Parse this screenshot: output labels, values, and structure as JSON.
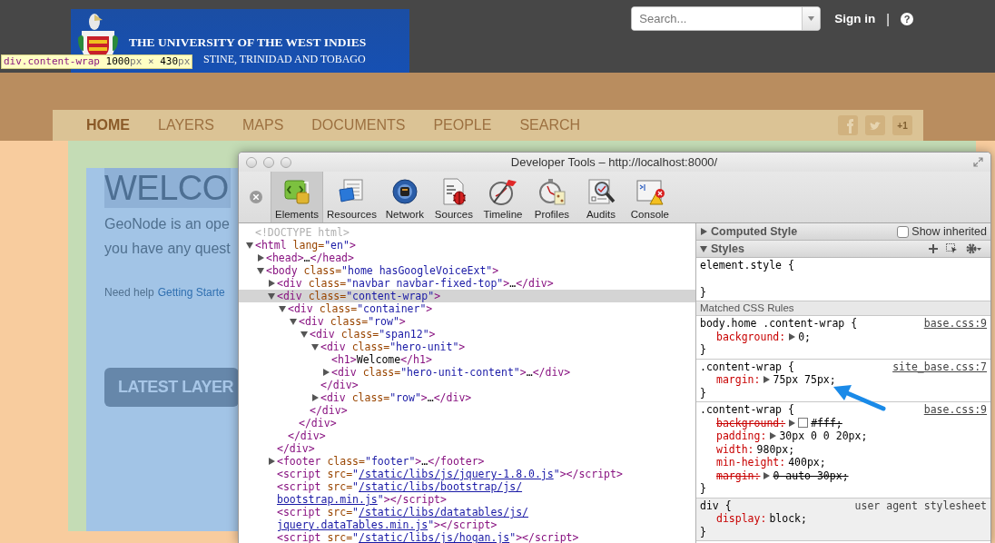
{
  "page": {
    "logo": {
      "title": "THE UNIVERSITY OF THE WEST INDIES",
      "subtitle": "STINE, TRINIDAD AND TOBAGO"
    },
    "search": {
      "placeholder": "Search..."
    },
    "sign_in": "Sign in",
    "divider": "|",
    "help": "?",
    "nav": [
      {
        "label": "HOME",
        "selected": true
      },
      {
        "label": "LAYERS",
        "selected": false
      },
      {
        "label": "MAPS",
        "selected": false
      },
      {
        "label": "DOCUMENTS",
        "selected": false
      },
      {
        "label": "PEOPLE",
        "selected": false
      },
      {
        "label": "SEARCH",
        "selected": false
      }
    ],
    "social": [
      {
        "kind": "facebook"
      },
      {
        "kind": "twitter"
      },
      {
        "kind": "plusone",
        "label": "+1"
      }
    ],
    "hero": {
      "heading": "WELCO",
      "lines": [
        "GeoNode is an ope",
        "you have any quest"
      ],
      "help_text": "Need help",
      "help_link": "Getting Starte",
      "button": "LATEST LAYER"
    }
  },
  "tooltip": {
    "parts": [
      {
        "text": "div.content-wrap ",
        "kind": "selector"
      },
      {
        "text": "1000",
        "kind": "number"
      },
      {
        "text": "px × ",
        "kind": "unit"
      },
      {
        "text": "430",
        "kind": "number"
      },
      {
        "text": "px",
        "kind": "unit"
      }
    ]
  },
  "devtools": {
    "title": "Developer Tools – http://localhost:8000/",
    "tabs": [
      {
        "label": "Elements",
        "selected": true
      },
      {
        "label": "Resources",
        "selected": false
      },
      {
        "label": "Network",
        "selected": false
      },
      {
        "label": "Sources",
        "selected": false
      },
      {
        "label": "Timeline",
        "selected": false
      },
      {
        "label": "Profiles",
        "selected": false
      },
      {
        "label": "Audits",
        "selected": false
      },
      {
        "label": "Console",
        "selected": false
      }
    ]
  },
  "elements": {
    "nodes": [
      {
        "kind": "doctype",
        "text": "<!DOCTYPE html>",
        "selected": false
      },
      {
        "kind": "element",
        "text": "<html lang=\"en\">",
        "selected": false,
        "expanded": true,
        "children": [
          {
            "kind": "element",
            "text": "<head>…</head>",
            "selected": false,
            "expanded": false
          },
          {
            "kind": "element",
            "text": "<body class=\"home hasGoogleVoiceExt\">",
            "selected": false,
            "expanded": true,
            "children": [
              {
                "kind": "element",
                "text": "<div class=\"navbar navbar-fixed-top\">…</div>",
                "selected": false,
                "expanded": false
              },
              {
                "kind": "element",
                "text": "<div class=\"content-wrap\">",
                "selected": true,
                "expanded": true,
                "close": "</div>",
                "children": [
                  {
                    "kind": "element",
                    "text": "<div class=\"container\">",
                    "selected": false,
                    "expanded": true,
                    "close": "</div>",
                    "children": [
                      {
                        "kind": "element",
                        "text": "<div class=\"row\">",
                        "selected": false,
                        "expanded": true,
                        "close": "</div>",
                        "children": [
                          {
                            "kind": "element",
                            "text": "<div class=\"span12\">",
                            "selected": false,
                            "expanded": true,
                            "close": "</div>",
                            "children": [
                              {
                                "kind": "element",
                                "text": "<div class=\"hero-unit\">",
                                "selected": false,
                                "expanded": true,
                                "close": "</div>",
                                "children": [
                                  {
                                    "kind": "element",
                                    "text": "<h1>Welcome</h1>",
                                    "selected": false
                                  },
                                  {
                                    "kind": "element",
                                    "text": "<div class=\"hero-unit-content\">…</div>",
                                    "selected": false,
                                    "expanded": false
                                  }
                                ]
                              },
                              {
                                "kind": "element",
                                "text": "<div class=\"row\">…</div>",
                                "selected": false,
                                "expanded": false
                              }
                            ]
                          }
                        ]
                      }
                    ]
                  }
                ]
              },
              {
                "kind": "element",
                "text": "<footer class=\"footer\">…</footer>",
                "selected": false,
                "expanded": false
              },
              {
                "kind": "element",
                "text": "<script src=\"/static/libs/js/jquery-1.8.0.js\"></script>",
                "selected": false,
                "links": true
              },
              {
                "kind": "element",
                "text": "<script src=\"/static/libs/bootstrap/js/\nbootstrap.min.js\"></script>",
                "selected": false,
                "links": true
              },
              {
                "kind": "element",
                "text": "<script src=\"/static/libs/datatables/js/\njquery.dataTables.min.js\"></script>",
                "selected": false,
                "links": true
              },
              {
                "kind": "element",
                "text": "<script src=\"/static/libs/js/hogan.js\"></script>",
                "selected": false,
                "links": true
              }
            ]
          }
        ]
      }
    ]
  },
  "styles": {
    "computed": {
      "title": "Computed Style",
      "expanded": false,
      "show_inherited": {
        "label": "Show inherited",
        "checked": false
      }
    },
    "styles_header": {
      "title": "Styles",
      "expanded": true
    },
    "matched_label": "Matched CSS Rules",
    "rules": [
      {
        "kind": "inline",
        "selector": "element.style {",
        "close": "}"
      },
      {
        "kind": "author",
        "selector": "body.home .content-wrap {",
        "source": "base.css:9",
        "properties": [
          {
            "name": "background:",
            "value": "0;",
            "expandable": true,
            "overridden": false
          }
        ],
        "close": "}"
      },
      {
        "kind": "author",
        "selector": ".content-wrap {",
        "source": "site_base.css:7",
        "properties": [
          {
            "name": "margin:",
            "value": "75px 75px;",
            "expandable": true,
            "overridden": false
          }
        ],
        "close": "}"
      },
      {
        "kind": "author",
        "selector": ".content-wrap {",
        "source": "base.css:9",
        "properties": [
          {
            "name": "background:",
            "value": "#fff;",
            "expandable": true,
            "overridden": true,
            "swatch": true
          },
          {
            "name": "padding:",
            "value": "30px 0 0 20px;",
            "expandable": true,
            "overridden": false
          },
          {
            "name": "width:",
            "value": "980px;",
            "expandable": false,
            "overridden": false
          },
          {
            "name": "min-height:",
            "value": "400px;",
            "expandable": false,
            "overridden": false
          },
          {
            "name": "margin:",
            "value": "0 auto 30px;",
            "expandable": true,
            "overridden": true
          }
        ],
        "close": "}"
      },
      {
        "kind": "user-agent",
        "selector": "div {",
        "source": "user agent stylesheet",
        "properties": [
          {
            "name": "display:",
            "value": "block;",
            "expandable": false,
            "overridden": false
          }
        ],
        "close": "}"
      }
    ]
  }
}
